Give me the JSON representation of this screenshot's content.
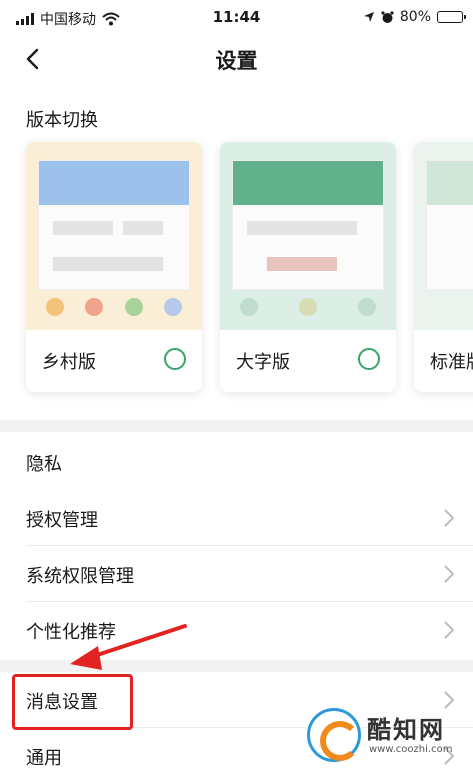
{
  "status_bar": {
    "carrier": "中国移动",
    "time": "11:44",
    "battery": "80%",
    "battery_level": 0.8
  },
  "nav": {
    "title": "设置",
    "back_icon": "chevron-left-icon"
  },
  "version_switch": {
    "heading": "版本切换",
    "options": [
      {
        "label": "乡村版",
        "accent": "#5b8fd6",
        "selected": false
      },
      {
        "label": "大字版",
        "accent": "#3f9e74",
        "selected": false
      },
      {
        "label": "标准版",
        "accent": "#cfe6d8",
        "selected": false
      }
    ]
  },
  "privacy": {
    "heading": "隐私",
    "items": [
      {
        "label": "授权管理"
      },
      {
        "label": "系统权限管理"
      },
      {
        "label": "个性化推荐"
      },
      {
        "label": "消息设置"
      },
      {
        "label": "通用"
      }
    ]
  },
  "colors": {
    "accent_green": "#36a36a",
    "highlight_red": "#e32222"
  },
  "watermark": {
    "name": "酷知网",
    "url": "www.coozhi.com"
  }
}
